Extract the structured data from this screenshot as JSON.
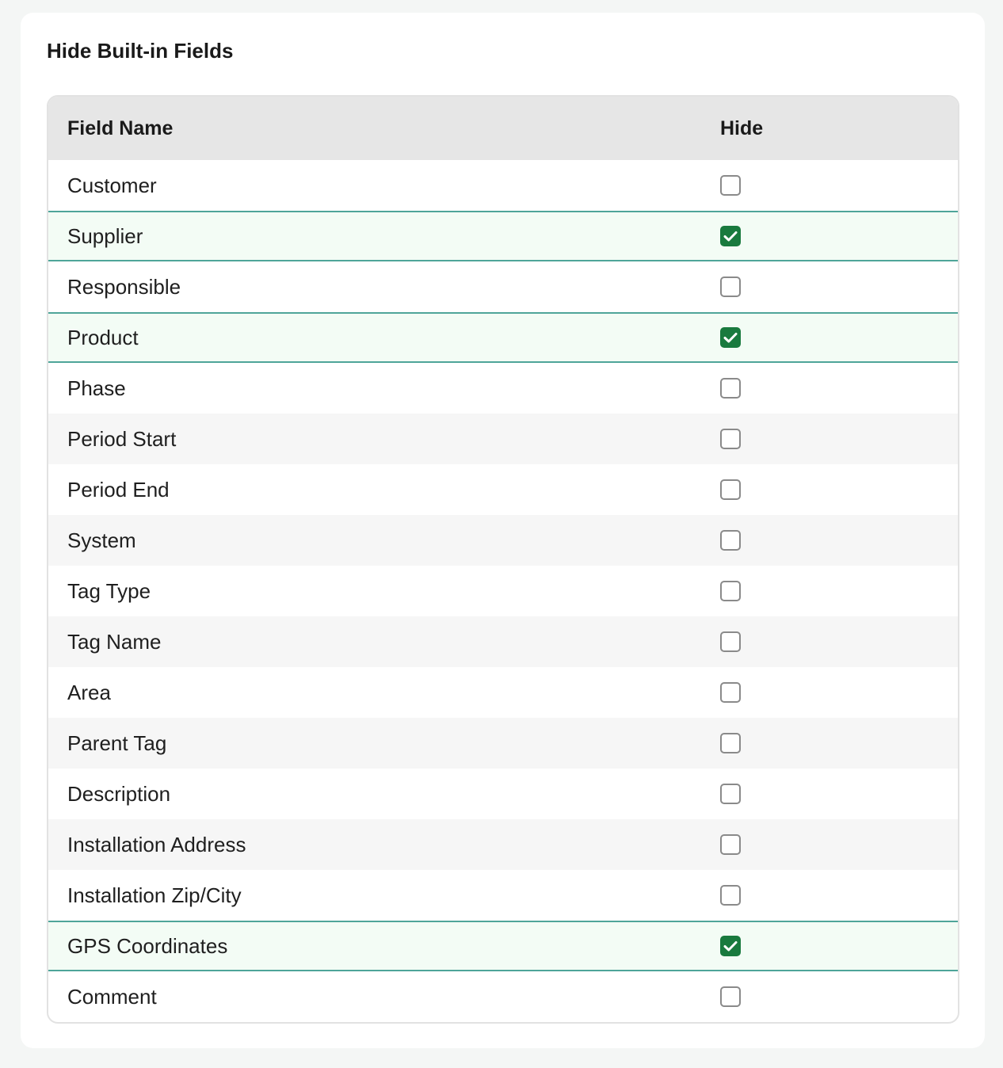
{
  "section": {
    "title": "Hide Built-in Fields"
  },
  "table": {
    "columns": {
      "field_name": "Field Name",
      "hide": "Hide"
    },
    "rows": [
      {
        "name": "Customer",
        "hidden": false
      },
      {
        "name": "Supplier",
        "hidden": true
      },
      {
        "name": "Responsible",
        "hidden": false
      },
      {
        "name": "Product",
        "hidden": true
      },
      {
        "name": "Phase",
        "hidden": false
      },
      {
        "name": "Period Start",
        "hidden": false
      },
      {
        "name": "Period End",
        "hidden": false
      },
      {
        "name": "System",
        "hidden": false
      },
      {
        "name": "Tag Type",
        "hidden": false
      },
      {
        "name": "Tag Name",
        "hidden": false
      },
      {
        "name": "Area",
        "hidden": false
      },
      {
        "name": "Parent Tag",
        "hidden": false
      },
      {
        "name": "Description",
        "hidden": false
      },
      {
        "name": "Installation Address",
        "hidden": false
      },
      {
        "name": "Installation Zip/City",
        "hidden": false
      },
      {
        "name": "GPS Coordinates",
        "hidden": true
      },
      {
        "name": "Comment",
        "hidden": false
      }
    ]
  },
  "colors": {
    "checked_fill": "#197a3e",
    "selected_row_bg": "#f3fcf5",
    "selected_row_border": "#4ea599"
  }
}
